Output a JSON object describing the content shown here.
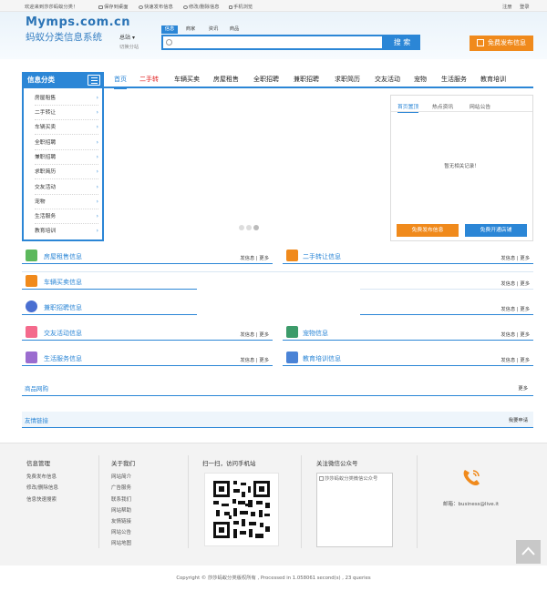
{
  "topbar": {
    "welcome": "欢迎来到莎莎蚂蚁分类！",
    "save_desktop": "保存到桌面",
    "quick_post": "快速发布信息",
    "edit_delete": "修改/删除信息",
    "mobile": "手机浏览",
    "register": "注册",
    "login": "登录"
  },
  "header": {
    "logo_en": "Mymps.com.cn",
    "logo_cn": "蚂蚁分类信息系统",
    "city": "总站",
    "city_switch": "切换分站",
    "search_tabs": [
      "信息",
      "商家",
      "资讯",
      "商品"
    ],
    "search_placeholder": "",
    "search_button": "搜 索",
    "publish_button": "免费发布信息"
  },
  "nav": [
    "首页",
    "二手转",
    "车辆买卖",
    "房屋租售",
    "全职招聘",
    "兼职招聘",
    "求职简历",
    "交友活动",
    "宠物",
    "生活服务",
    "教育培训"
  ],
  "sidebar": {
    "title": "信息分类",
    "items": [
      "房屋租售",
      "二手转让",
      "车辆买卖",
      "全职招聘",
      "兼职招聘",
      "求职简历",
      "交友活动",
      "宠物",
      "生活服务",
      "教育培训"
    ]
  },
  "news": {
    "tabs": [
      "首页置顶",
      "热点资讯",
      "网站公告"
    ],
    "empty": "暂无相关记录！",
    "btn_free": "免费发布信息",
    "btn_shop": "免费开通店铺"
  },
  "categories": [
    {
      "title": "房屋租售信息",
      "color": "#5cb85c"
    },
    {
      "title": "二手转让信息",
      "color": "#f08a1c"
    },
    {
      "title": "车辆买卖信息",
      "color": "#f08a1c"
    },
    {
      "title": "兼职招聘信息",
      "color": "#4a6fd1"
    },
    {
      "title": "交友活动信息",
      "color": "#f46a8c"
    },
    {
      "title": "宠物信息",
      "color": "#3c9b6a"
    },
    {
      "title": "生活服务信息",
      "color": "#9b6ccf"
    },
    {
      "title": "教育培训信息",
      "color": "#4a83d6"
    }
  ],
  "more_links": "发信息 | 更多",
  "products": {
    "title": "商品网购",
    "more": "更多"
  },
  "links": {
    "title": "友情链接",
    "apply": "我要申请"
  },
  "footer": {
    "col1_title": "信息管理",
    "col1": [
      "免费发布信息",
      "修改/删除信息",
      "信息快速搜索"
    ],
    "col2_title": "关于我们",
    "col2": [
      "网站简介",
      "广告服务",
      "联系我们",
      "网站帮助",
      "友情链接",
      "网站公告",
      "网站地图"
    ],
    "col3_title": "扫一扫，访问手机站",
    "col4_title": "关注微信公众号",
    "wechat_alt": "莎莎蚂蚁分类微信公众号",
    "email": "邮箱：business@live.it"
  },
  "copyright": "Copyright © 莎莎蚂蚁分类版权所有 , Processed in 1.058061 second(s) , 23 queries",
  "colors": {
    "accent": "#2b86d6",
    "orange": "#f08a1c",
    "red": "#e02020"
  }
}
